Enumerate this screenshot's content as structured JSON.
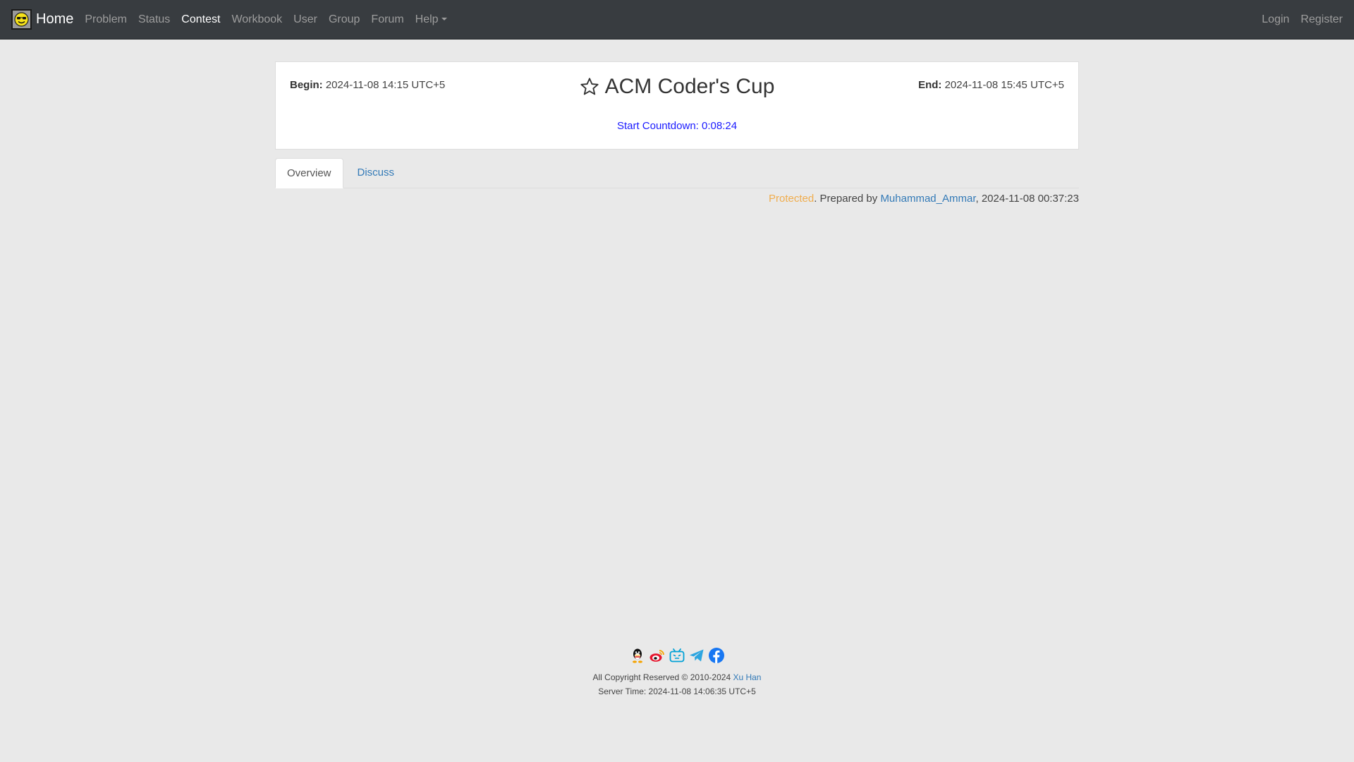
{
  "navbar": {
    "brand": "Home",
    "items": [
      {
        "label": "Problem"
      },
      {
        "label": "Status"
      },
      {
        "label": "Contest"
      },
      {
        "label": "Workbook"
      },
      {
        "label": "User"
      },
      {
        "label": "Group"
      },
      {
        "label": "Forum"
      },
      {
        "label": "Help"
      }
    ],
    "active": "Contest",
    "right": {
      "login": "Login",
      "register": "Register"
    }
  },
  "contest": {
    "begin_label": "Begin:",
    "begin": "2024-11-08 14:15 UTC+5",
    "end_label": "End:",
    "end": "2024-11-08 15:45 UTC+5",
    "title": "ACM Coder's Cup",
    "countdown": "Start Countdown: 0:08:24"
  },
  "tabs": [
    {
      "label": "Overview"
    },
    {
      "label": "Discuss"
    }
  ],
  "meta": {
    "status": "Protected",
    "prepared_by_text": ". Prepared by ",
    "author": "Muhammad_Ammar",
    "created": ", 2024-11-08 00:37:23"
  },
  "footer": {
    "social_icons": [
      "qq-icon",
      "weibo-icon",
      "bilibili-icon",
      "telegram-icon",
      "facebook-icon"
    ],
    "copyright": "All Copyright Reserved © 2010-2024 ",
    "copyright_author": "Xu Han",
    "server_time": "Server Time: 2024-11-08 14:06:35 UTC+5"
  },
  "colors": {
    "navbar_bg": "#383c40",
    "page_bg": "#e9e9e9",
    "link": "#337ab7",
    "countdown": "#1a1aff",
    "protected": "#f0ad4e"
  }
}
